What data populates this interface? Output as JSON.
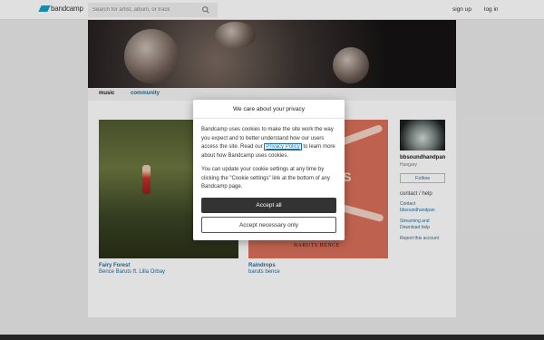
{
  "nav": {
    "logo_text": "bandcamp",
    "search_placeholder": "Search for artist, album, or track",
    "signup": "sign up",
    "login": "log in"
  },
  "tabs": {
    "music": "music",
    "community": "community"
  },
  "albums": [
    {
      "title": "Fairy Forest",
      "artist": "Bence Baruts ft. Lilla Orbay"
    },
    {
      "title": "Raindrops",
      "artist": "baruts bence",
      "cover_text": "BARUTS BENCE",
      "cover_big": "OPS"
    }
  ],
  "artist": {
    "name": "bbsoundhandpan",
    "location": "Hungary",
    "follow": "Follow",
    "contact_heading": "contact / help",
    "links": [
      "Contact bbsoundhandpan",
      "Streaming and Download help",
      "Report this account"
    ]
  },
  "cookie_dialog": {
    "title": "We care about your privacy",
    "para1_before": "Bandcamp uses cookies to make the site work the way you expect and to better understand how our users access the site. Read our ",
    "privacy_link": "Privacy Policy",
    "para1_after": " to learn more about how Bandcamp uses cookies.",
    "para2": "You can update your cookie settings at any time by clicking the \"Cookie settings\" link at the bottom of any Bandcamp page.",
    "accept_all": "Accept all",
    "accept_necessary": "Accept necessary only"
  },
  "colors": {
    "link": "#1d6fa3",
    "brand": "#1da0c3",
    "primary_button": "#333333"
  }
}
